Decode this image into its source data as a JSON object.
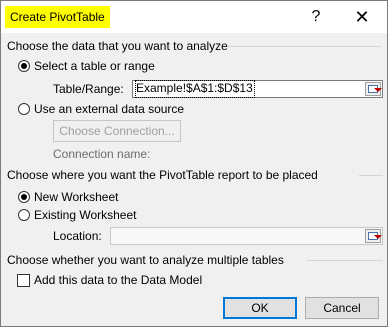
{
  "title": "Create PivotTable",
  "titlebar": {
    "help_glyph": "?",
    "close_glyph": "✕"
  },
  "section1": {
    "heading": "Choose the data that you want to analyze",
    "select_table_label": "Select a table or range",
    "table_range_label": "Table/Range:",
    "table_range_value": "Example!$A$1:$D$13",
    "external_label": "Use an external data source",
    "choose_connection_label": "Choose Connection...",
    "connection_name_label": "Connection name:"
  },
  "section2": {
    "heading": "Choose where you want the PivotTable report to be placed",
    "new_worksheet_label": "New Worksheet",
    "existing_worksheet_label": "Existing Worksheet",
    "location_label": "Location:",
    "location_value": ""
  },
  "section3": {
    "heading": "Choose whether you want to analyze multiple tables",
    "data_model_label": "Add this data to the Data Model"
  },
  "buttons": {
    "ok_label": "OK",
    "cancel_label": "Cancel"
  },
  "state": {
    "source": "table_or_range",
    "destination": "new_worksheet",
    "add_to_data_model": false
  }
}
